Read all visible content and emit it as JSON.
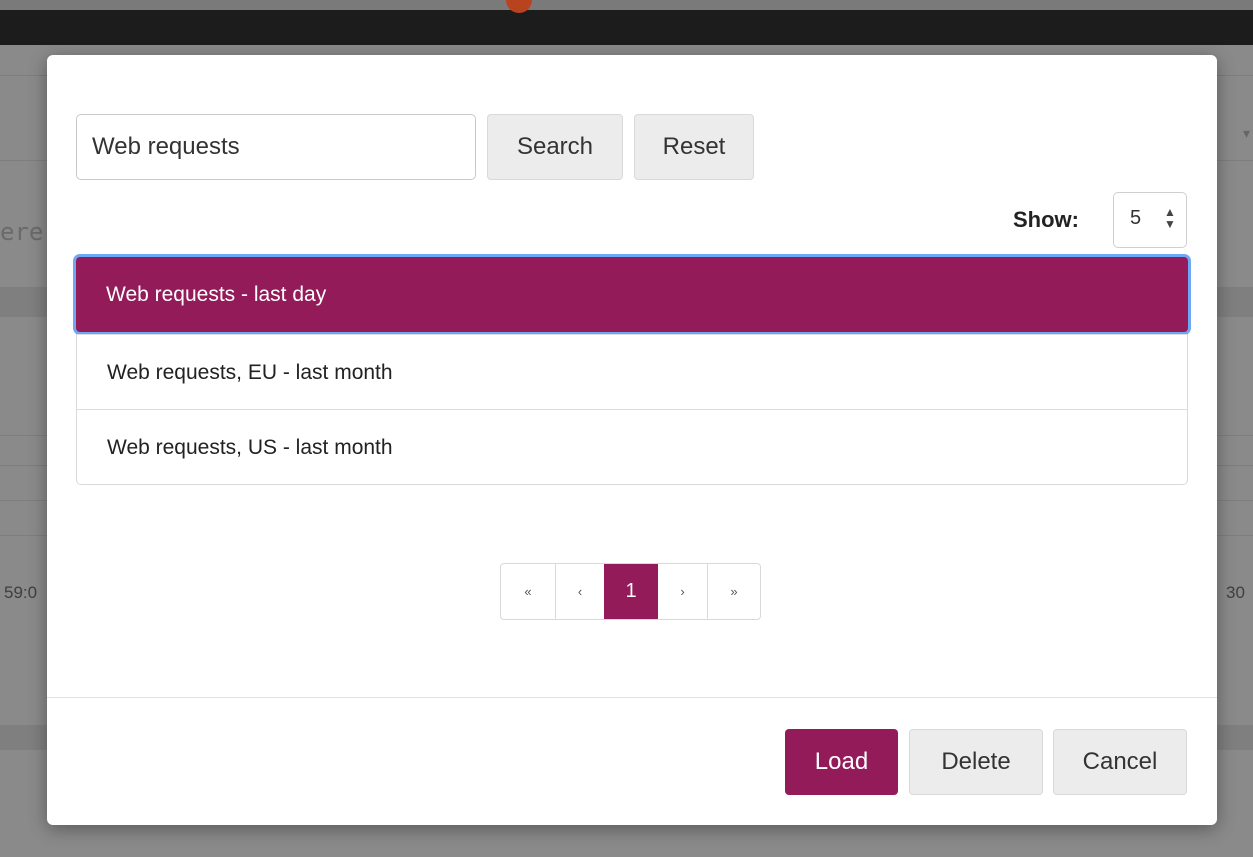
{
  "background": {
    "left_text": "ere",
    "left_number": "59:0",
    "right_number": "30"
  },
  "dialog": {
    "search": {
      "value": "Web requests",
      "button": "Search",
      "reset": "Reset"
    },
    "show": {
      "label": "Show:",
      "value": "5",
      "arrows": "▲▼"
    },
    "items": [
      {
        "label": "Web requests - last day",
        "selected": true
      },
      {
        "label": "Web requests, EU - last month",
        "selected": false
      },
      {
        "label": "Web requests, US - last month",
        "selected": false
      }
    ],
    "pagination": {
      "first": "«",
      "prev": "‹",
      "current": "1",
      "next": "›",
      "last": "»"
    },
    "footer": {
      "load": "Load",
      "delete": "Delete",
      "cancel": "Cancel"
    }
  },
  "colors": {
    "accent": "#941b5a",
    "focus_ring": "#6fa7f5"
  }
}
